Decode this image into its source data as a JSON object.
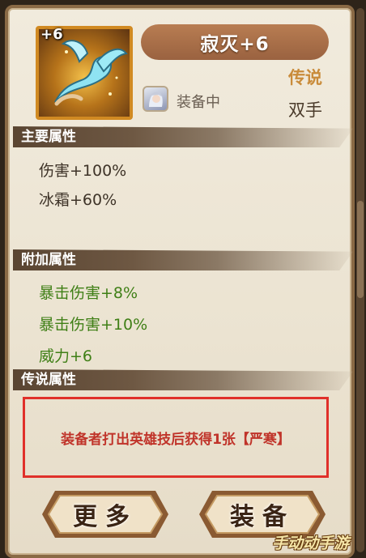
{
  "item": {
    "level": "+6",
    "name": "寂灭+6",
    "rarity": "传说",
    "hand_type": "双手",
    "equipped_text": "装备中"
  },
  "sections": {
    "main_title": "主要属性",
    "extra_title": "附加属性",
    "legend_title": "传说属性"
  },
  "main_attrs": [
    "伤害+100%",
    "冰霜+60%"
  ],
  "extra_attrs": [
    "暴击伤害+8%",
    "暴击伤害+10%",
    "威力+6"
  ],
  "legend_text": "装备者打出英雄技后获得1张【严寒】",
  "buttons": {
    "more": "更多",
    "equip": "装备"
  },
  "watermark": "手动动手游",
  "colors": {
    "rarity": "#c98b3a",
    "extra_attr": "#3f7f16",
    "legend_text": "#c0342a",
    "highlight_box": "#e0302a"
  }
}
